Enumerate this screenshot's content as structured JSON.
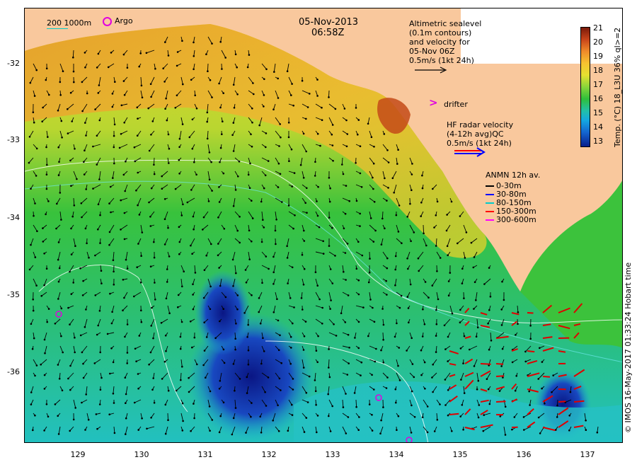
{
  "map": {
    "date": "05-Nov-2013",
    "time": "06:58Z",
    "y_ticks": [
      "-32",
      "-33",
      "-34",
      "-35",
      "-36"
    ],
    "x_ticks": [
      "129",
      "130",
      "131",
      "132",
      "133",
      "134",
      "135",
      "136",
      "137"
    ],
    "contour_label": "200  1000m",
    "argo_label": "Argo",
    "altimetry_text": [
      "Altimetric sealevel",
      "(0.1m contours)",
      "and velocity for",
      "05-Nov 06Z",
      "0.5m/s (1kt 24h)"
    ],
    "drifter_label": "drifter",
    "hf_radar_text": [
      "HF radar velocity",
      "(4-12h avg)QC",
      "0.5m/s (1kt 24h)"
    ],
    "anmn_title": "ANMN 12h av.",
    "anmn_legend": [
      {
        "label": "0-30m",
        "color": "#000000"
      },
      {
        "label": "30-80m",
        "color": "#0000ff"
      },
      {
        "label": "80-150m",
        "color": "#00cccc"
      },
      {
        "label": "150-300m",
        "color": "#ff0000"
      },
      {
        "label": "300-600m",
        "color": "#ff00ff"
      }
    ],
    "colorbar": {
      "ticks": [
        "21",
        "20",
        "19",
        "18",
        "17",
        "16",
        "15",
        "14",
        "13"
      ],
      "title": "Temp. (°C) 18_L3U 36% ql>=2"
    },
    "credit": "© IMOS 16-May-2017 01:33:24 Hobart time",
    "colors": {
      "land": "#f9c89d",
      "cold": "#0a1e8c",
      "cool": "#12a6d8",
      "mid": "#2cbd3c",
      "warm": "#e8d630",
      "hot": "#c8581c"
    }
  }
}
